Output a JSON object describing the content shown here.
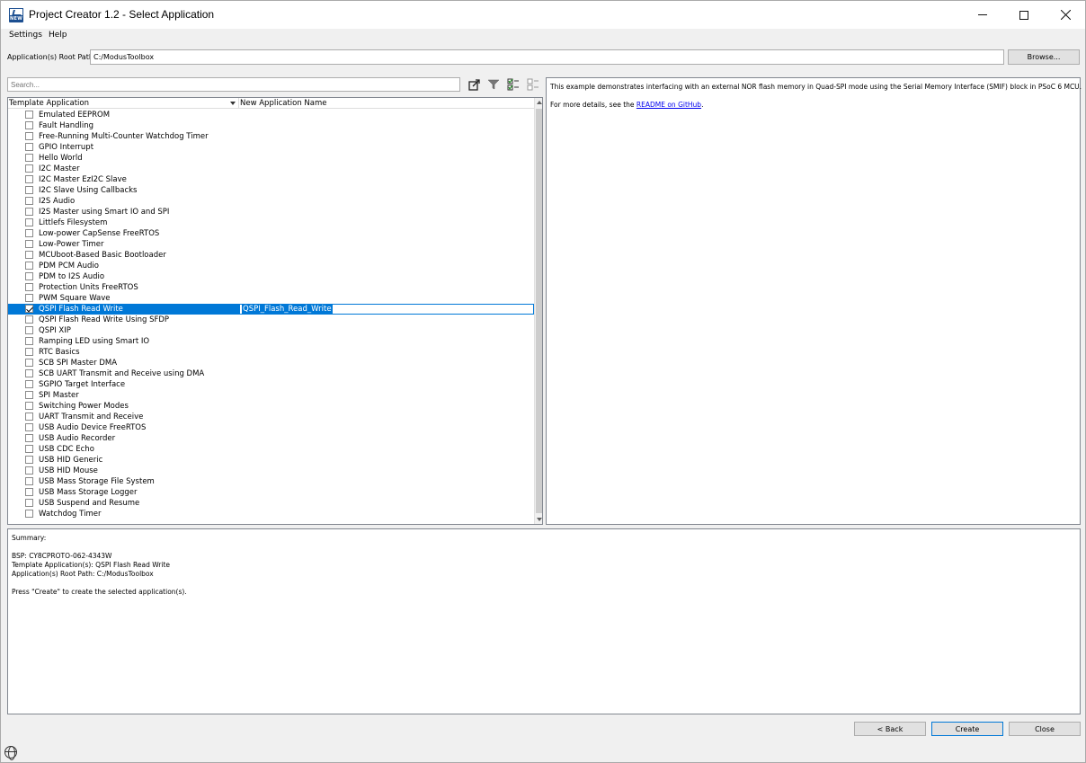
{
  "window": {
    "title": "Project Creator 1.2 - Select Application",
    "icon_badge": "NEW"
  },
  "menu": {
    "settings": "Settings",
    "help": "Help"
  },
  "root_path": {
    "label": "Application(s) Root Path:",
    "value": "C:/ModusToolbox",
    "browse_label": "Browse..."
  },
  "search": {
    "placeholder": "Search..."
  },
  "table": {
    "col_template": "Template Application",
    "col_new_name": "New Application Name",
    "rows": [
      {
        "name": "Emulated EEPROM",
        "checked": false
      },
      {
        "name": "Fault Handling",
        "checked": false
      },
      {
        "name": "Free-Running Multi-Counter Watchdog Timer",
        "checked": false
      },
      {
        "name": "GPIO Interrupt",
        "checked": false
      },
      {
        "name": "Hello World",
        "checked": false
      },
      {
        "name": "I2C Master",
        "checked": false
      },
      {
        "name": "I2C Master EzI2C Slave",
        "checked": false
      },
      {
        "name": "I2C Slave Using Callbacks",
        "checked": false
      },
      {
        "name": "I2S Audio",
        "checked": false
      },
      {
        "name": "I2S Master using Smart IO and SPI",
        "checked": false
      },
      {
        "name": "Littlefs Filesystem",
        "checked": false
      },
      {
        "name": "Low-power CapSense FreeRTOS",
        "checked": false
      },
      {
        "name": "Low-Power Timer",
        "checked": false
      },
      {
        "name": "MCUboot-Based Basic Bootloader",
        "checked": false
      },
      {
        "name": "PDM PCM Audio",
        "checked": false
      },
      {
        "name": "PDM to I2S Audio",
        "checked": false
      },
      {
        "name": "Protection Units FreeRTOS",
        "checked": false
      },
      {
        "name": "PWM Square Wave",
        "checked": false
      },
      {
        "name": "QSPI Flash Read Write",
        "checked": true,
        "selected": true,
        "new_name": "QSPI_Flash_Read_Write"
      },
      {
        "name": "QSPI Flash Read Write Using SFDP",
        "checked": false
      },
      {
        "name": "QSPI XIP",
        "checked": false
      },
      {
        "name": "Ramping LED using Smart IO",
        "checked": false
      },
      {
        "name": "RTC Basics",
        "checked": false
      },
      {
        "name": "SCB SPI Master DMA",
        "checked": false
      },
      {
        "name": "SCB UART Transmit and Receive using DMA",
        "checked": false
      },
      {
        "name": "SGPIO Target Interface",
        "checked": false
      },
      {
        "name": "SPI Master",
        "checked": false
      },
      {
        "name": "Switching Power Modes",
        "checked": false
      },
      {
        "name": "UART Transmit and Receive",
        "checked": false
      },
      {
        "name": "USB Audio Device FreeRTOS",
        "checked": false
      },
      {
        "name": "USB Audio Recorder",
        "checked": false
      },
      {
        "name": "USB CDC Echo",
        "checked": false
      },
      {
        "name": "USB HID Generic",
        "checked": false
      },
      {
        "name": "USB HID Mouse",
        "checked": false
      },
      {
        "name": "USB Mass Storage File System",
        "checked": false
      },
      {
        "name": "USB Mass Storage Logger",
        "checked": false
      },
      {
        "name": "USB Suspend and Resume",
        "checked": false
      },
      {
        "name": "Watchdog Timer",
        "checked": false
      }
    ]
  },
  "description": {
    "text": "This example demonstrates interfacing with an external NOR flash memory in Quad-SPI mode using the Serial Memory Interface (SMIF) block in PSoC 6 MCU.",
    "more_prefix": "For more details, see the ",
    "link_text": "README on GitHub",
    "more_suffix": "."
  },
  "summary": {
    "heading": "Summary:",
    "bsp": "BSP: CY8CPROTO-062-4343W",
    "template": "Template Application(s): QSPI Flash Read Write",
    "root": "Application(s) Root Path: C:/ModusToolbox",
    "instruction": "Press \"Create\" to create the selected application(s)."
  },
  "buttons": {
    "back": "< Back",
    "create": "Create",
    "close": "Close"
  },
  "colors": {
    "selection": "#0078d7",
    "link": "#0000ee",
    "icon_blue": "#1c4f91"
  }
}
